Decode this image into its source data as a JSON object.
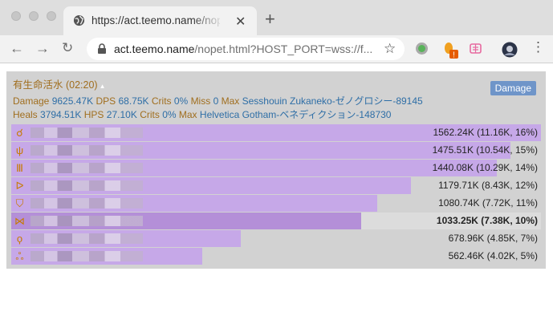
{
  "browser": {
    "tab_title": "https://act.teemo.name/nopet.html",
    "url_host": "act.teemo.name",
    "url_rest": "/nopet.html?HOST_PORT=wss://f..."
  },
  "overlay": {
    "encounter": "有生命活水 (02:20)",
    "damage_button": "Damage",
    "stats1": {
      "damage_label": "Damage",
      "damage_value": "9625.47K",
      "dps_label": "DPS",
      "dps_value": "68.75K",
      "crits_label": "Crits",
      "crits_value": "0%",
      "miss_label": "Miss",
      "miss_value": "0",
      "max_label": "Max",
      "max_value": "Sesshouin Zukaneko-ゼノグロシー-89145"
    },
    "stats2": {
      "heals_label": "Heals",
      "heals_value": "3794.51K",
      "hps_label": "HPS",
      "hps_value": "27.10K",
      "crits_label": "Crits",
      "crits_value": "0%",
      "max_label": "Max",
      "max_value": "Helvetica Gotham-ベネディクション-148730"
    },
    "rows": [
      {
        "job_icon": "astrologian-icon",
        "stat": "1562.24K (11.16K, 16%)",
        "fraction": 1.0,
        "self": false
      },
      {
        "job_icon": "scholar-icon",
        "stat": "1475.51K (10.54K, 15%)",
        "fraction": 0.942,
        "self": false
      },
      {
        "job_icon": "dragoon-icon",
        "stat": "1440.08K (10.29K, 14%)",
        "fraction": 0.917,
        "self": false
      },
      {
        "job_icon": "bard-icon",
        "stat": "1179.71K (8.43K, 12%)",
        "fraction": 0.755,
        "self": false
      },
      {
        "job_icon": "paladin-icon",
        "stat": "1080.74K (7.72K, 11%)",
        "fraction": 0.691,
        "self": false
      },
      {
        "job_icon": "ninja-icon",
        "stat": "1033.25K (7.38K, 10%)",
        "fraction": 0.661,
        "self": true
      },
      {
        "job_icon": "white-mage-icon",
        "stat": "678.96K (4.85K, 7%)",
        "fraction": 0.434,
        "self": false
      },
      {
        "job_icon": "warrior-icon",
        "stat": "562.46K (4.02K, 5%)",
        "fraction": 0.36,
        "self": false
      }
    ],
    "colors": {
      "bar": "#c6a8e8",
      "self_bar": "#b48fd8",
      "label": "#a06e1e",
      "value": "#2e6ea6"
    }
  }
}
